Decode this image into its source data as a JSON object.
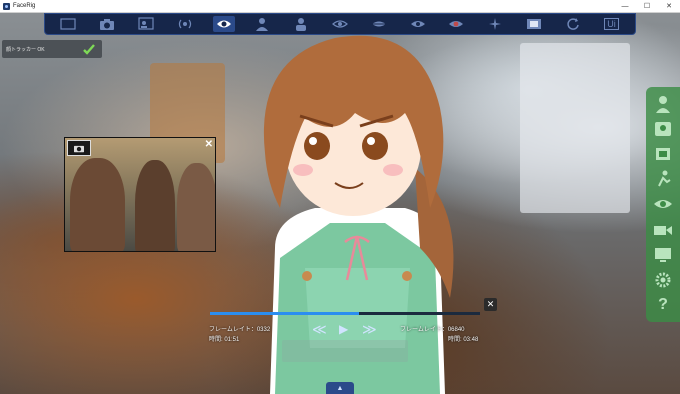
{
  "window": {
    "title": "FaceRig",
    "minimize": "—",
    "maximize": "☐",
    "close": "✕"
  },
  "toolbar": {
    "items": [
      {
        "name": "fullscreen-icon"
      },
      {
        "name": "camera-icon"
      },
      {
        "name": "screen-icon"
      },
      {
        "name": "broadcast-icon"
      },
      {
        "name": "eye-pointer-icon",
        "active": true
      },
      {
        "name": "avatar-icon"
      },
      {
        "name": "person-icon"
      },
      {
        "name": "eye-icon"
      },
      {
        "name": "mouth-icon"
      },
      {
        "name": "eye-right-icon"
      },
      {
        "name": "eye-record-icon"
      },
      {
        "name": "sparkle-icon"
      },
      {
        "name": "film-icon"
      },
      {
        "name": "refresh-icon"
      },
      {
        "name": "ui-icon",
        "label": "Ui"
      }
    ]
  },
  "status": {
    "text": "顔トラッカー OK"
  },
  "player": {
    "framerate_left": "フレームレイト：0332",
    "framerate_right": "フレームレイト：06840",
    "time_left": "時間: 01:51",
    "time_right": "時間: 03:48",
    "progress": 0.55,
    "close": "✕",
    "rewind": "≪",
    "play": "▶",
    "forward": "≫"
  },
  "bottom_tab": {
    "label": "▲"
  },
  "colors": {
    "toolbar_bg": "#16264a",
    "sidebar_bg": "#3c8c46",
    "accent": "#2b8ef0"
  }
}
